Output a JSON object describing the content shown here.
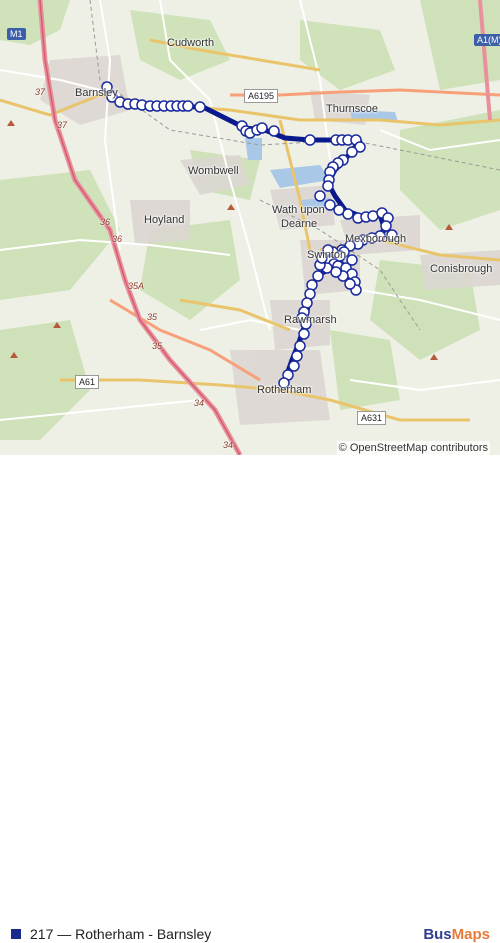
{
  "map": {
    "places": [
      {
        "name": "Cudworth",
        "key": "cudworth"
      },
      {
        "name": "Barnsley",
        "key": "barnsley"
      },
      {
        "name": "Thurnscoe",
        "key": "thurnscoe"
      },
      {
        "name": "Wombwell",
        "key": "wombwell"
      },
      {
        "name": "Hoyland",
        "key": "hoyland"
      },
      {
        "name": "Wath upon",
        "key": "wath1"
      },
      {
        "name": "Dearne",
        "key": "wath2"
      },
      {
        "name": "Mexborough",
        "key": "mexborough"
      },
      {
        "name": "Conisbrough",
        "key": "conisbrough"
      },
      {
        "name": "Swinton",
        "key": "swinton"
      },
      {
        "name": "Rawmarsh",
        "key": "rawmarsh"
      },
      {
        "name": "Rotherham",
        "key": "rotherham"
      }
    ],
    "roads": {
      "m1": "M1",
      "a6195": "A6195",
      "a61": "A61",
      "a631": "A631",
      "a1m": "A1(M)",
      "j37a": "37",
      "j37b": "37",
      "j36a": "36",
      "j36b": "36",
      "j35a": "35A",
      "j35b": "35",
      "j35c": "35",
      "j34a": "34",
      "j34b": "34"
    },
    "route_color": "#0a1a8c",
    "stop_fill": "#ffffff",
    "stop_stroke": "#1a2a9c"
  },
  "attribution": "© OpenStreetMap contributors",
  "legend": {
    "route_label": "217 — Rotherham - Barnsley",
    "swatch_color": "#1a2a8c"
  },
  "brand": {
    "part1": "Bus",
    "part2": "Maps"
  }
}
